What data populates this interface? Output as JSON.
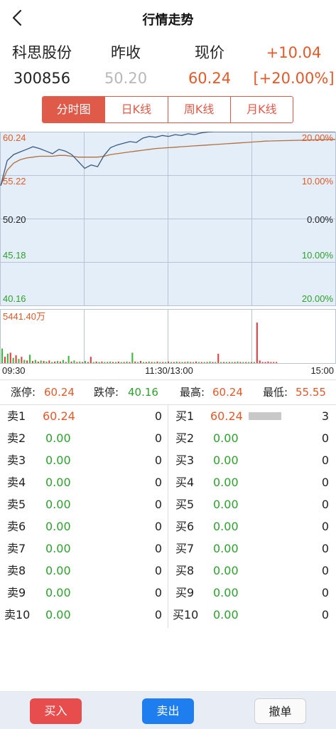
{
  "header": {
    "title": "行情走势",
    "back_icon": "chevron-left-icon"
  },
  "quote": {
    "name": "科思股份",
    "code": "300856",
    "prev_close_label": "昨收",
    "prev_close": "50.20",
    "current_label": "现价",
    "current": "60.24",
    "change": "+10.04",
    "change_pct": "[+20.00%]"
  },
  "tabs": [
    {
      "label": "分时图",
      "active": true
    },
    {
      "label": "日K线",
      "active": false
    },
    {
      "label": "周K线",
      "active": false
    },
    {
      "label": "月K线",
      "active": false
    }
  ],
  "chart_data": {
    "type": "line",
    "price_levels": [
      "60.24",
      "55.22",
      "50.20",
      "45.18",
      "40.16"
    ],
    "pct_levels": [
      "20.00%",
      "10.00%",
      "0.00%",
      "10.00%",
      "20.00%"
    ],
    "volume_label": "5441.40万",
    "x_ticks": [
      "09:30",
      "11:30/13:00",
      "15:00"
    ],
    "ylim": [
      40.16,
      60.24
    ],
    "reference": 50.2,
    "series": [
      {
        "values": [
          54.0,
          56.9,
          57.6,
          57.9,
          58.2,
          58.5,
          58.3,
          58.0,
          57.7,
          58.2,
          58.0,
          57.6,
          56.8,
          56.0,
          56.4,
          56.2,
          57.5,
          58.4,
          58.7,
          58.9,
          59.1,
          59.0,
          59.5,
          59.7,
          59.6,
          59.8,
          59.7,
          59.9,
          59.8,
          60.0,
          59.9,
          60.1,
          60.2,
          60.24,
          60.24,
          60.24,
          60.24,
          60.24,
          60.24,
          60.24,
          60.24,
          60.24
        ]
      },
      {
        "values": [
          54.0,
          55.8,
          56.6,
          57.0,
          57.2,
          57.3,
          57.4,
          57.4,
          57.4,
          57.5,
          57.5,
          57.4,
          57.3,
          57.3,
          57.3,
          57.3,
          57.4,
          57.6,
          57.7,
          57.8,
          57.9,
          58.0,
          58.1,
          58.2,
          58.3,
          58.35,
          58.4,
          58.45,
          58.5,
          58.55,
          58.6,
          58.65,
          58.7,
          58.75,
          58.8,
          58.85,
          58.9,
          58.95,
          59.0,
          59.05,
          59.1,
          59.15
        ]
      }
    ],
    "volume": [
      {
        "v": 0.28,
        "c": "green"
      },
      {
        "v": 0.12,
        "c": "red"
      },
      {
        "v": 0.18,
        "c": "green"
      },
      {
        "v": 0.2,
        "c": "red"
      },
      {
        "v": 0.1,
        "c": "green"
      },
      {
        "v": 0.15,
        "c": "red"
      },
      {
        "v": 0.08,
        "c": "green"
      },
      {
        "v": 0.12,
        "c": "red"
      },
      {
        "v": 0.06,
        "c": "green"
      },
      {
        "v": 0.05,
        "c": "red"
      },
      {
        "v": 0.16,
        "c": "green"
      },
      {
        "v": 0.04,
        "c": "red"
      },
      {
        "v": 0.06,
        "c": "green"
      },
      {
        "v": 0.03,
        "c": "red"
      },
      {
        "v": 0.05,
        "c": "green"
      },
      {
        "v": 0.04,
        "c": "red"
      },
      {
        "v": 0.03,
        "c": "green"
      },
      {
        "v": 0.05,
        "c": "red"
      },
      {
        "v": 0.02,
        "c": "green"
      },
      {
        "v": 0.03,
        "c": "red"
      },
      {
        "v": 0.04,
        "c": "green"
      },
      {
        "v": 0.03,
        "c": "red"
      },
      {
        "v": 0.06,
        "c": "green"
      },
      {
        "v": 0.02,
        "c": "red"
      },
      {
        "v": 0.14,
        "c": "green"
      },
      {
        "v": 0.03,
        "c": "red"
      },
      {
        "v": 0.05,
        "c": "green"
      },
      {
        "v": 0.02,
        "c": "red"
      },
      {
        "v": 0.03,
        "c": "green"
      },
      {
        "v": 0.02,
        "c": "red"
      },
      {
        "v": 0.04,
        "c": "green"
      },
      {
        "v": 0.02,
        "c": "red"
      },
      {
        "v": 0.12,
        "c": "red"
      },
      {
        "v": 0.02,
        "c": "green"
      },
      {
        "v": 0.03,
        "c": "red"
      },
      {
        "v": 0.02,
        "c": "green"
      },
      {
        "v": 0.03,
        "c": "red"
      },
      {
        "v": 0.02,
        "c": "green"
      },
      {
        "v": 0.02,
        "c": "red"
      },
      {
        "v": 0.03,
        "c": "green"
      },
      {
        "v": 0.02,
        "c": "red"
      },
      {
        "v": 0.02,
        "c": "green"
      },
      {
        "v": 0.03,
        "c": "red"
      },
      {
        "v": 0.02,
        "c": "green"
      },
      {
        "v": 0.02,
        "c": "red"
      },
      {
        "v": 0.03,
        "c": "green"
      },
      {
        "v": 0.02,
        "c": "red"
      },
      {
        "v": 0.2,
        "c": "green"
      },
      {
        "v": 0.03,
        "c": "red"
      },
      {
        "v": 0.02,
        "c": "green"
      },
      {
        "v": 0.04,
        "c": "red"
      },
      {
        "v": 0.02,
        "c": "green"
      },
      {
        "v": 0.02,
        "c": "red"
      },
      {
        "v": 0.03,
        "c": "green"
      },
      {
        "v": 0.02,
        "c": "red"
      },
      {
        "v": 0.02,
        "c": "green"
      },
      {
        "v": 0.03,
        "c": "red"
      },
      {
        "v": 0.02,
        "c": "green"
      },
      {
        "v": 0.02,
        "c": "red"
      },
      {
        "v": 0.02,
        "c": "green"
      },
      {
        "v": 0.03,
        "c": "red"
      },
      {
        "v": 0.02,
        "c": "green"
      },
      {
        "v": 0.02,
        "c": "red"
      },
      {
        "v": 0.03,
        "c": "green"
      },
      {
        "v": 0.02,
        "c": "red"
      },
      {
        "v": 0.02,
        "c": "green"
      },
      {
        "v": 0.02,
        "c": "red"
      },
      {
        "v": 0.03,
        "c": "green"
      },
      {
        "v": 0.02,
        "c": "red"
      },
      {
        "v": 0.02,
        "c": "green"
      },
      {
        "v": 0.03,
        "c": "red"
      },
      {
        "v": 0.02,
        "c": "green"
      },
      {
        "v": 0.02,
        "c": "red"
      },
      {
        "v": 0.02,
        "c": "green"
      },
      {
        "v": 0.02,
        "c": "red"
      },
      {
        "v": 0.03,
        "c": "green"
      },
      {
        "v": 0.02,
        "c": "red"
      },
      {
        "v": 0.02,
        "c": "green"
      },
      {
        "v": 0.18,
        "c": "red"
      },
      {
        "v": 0.02,
        "c": "green"
      },
      {
        "v": 0.02,
        "c": "red"
      },
      {
        "v": 0.02,
        "c": "green"
      },
      {
        "v": 0.02,
        "c": "red"
      },
      {
        "v": 0.02,
        "c": "green"
      },
      {
        "v": 0.02,
        "c": "red"
      },
      {
        "v": 0.03,
        "c": "green"
      },
      {
        "v": 0.02,
        "c": "red"
      },
      {
        "v": 0.02,
        "c": "green"
      },
      {
        "v": 0.02,
        "c": "red"
      },
      {
        "v": 0.02,
        "c": "green"
      },
      {
        "v": 0.02,
        "c": "red"
      },
      {
        "v": 0.02,
        "c": "green"
      },
      {
        "v": 0.78,
        "c": "red"
      },
      {
        "v": 0.05,
        "c": "red"
      },
      {
        "v": 0.02,
        "c": "red"
      },
      {
        "v": 0.02,
        "c": "red"
      },
      {
        "v": 0.03,
        "c": "red"
      },
      {
        "v": 0.02,
        "c": "red"
      },
      {
        "v": 0.02,
        "c": "red"
      },
      {
        "v": 0.02,
        "c": "red"
      }
    ]
  },
  "limits": {
    "up_label": "涨停:",
    "up": "60.24",
    "down_label": "跌停:",
    "down": "40.16",
    "high_label": "最高:",
    "high": "60.24",
    "low_label": "最低:",
    "low": "55.55"
  },
  "order_book": {
    "asks": [
      {
        "label": "卖1",
        "price": "60.24",
        "vol": "0"
      },
      {
        "label": "卖2",
        "price": "0.00",
        "vol": "0"
      },
      {
        "label": "卖3",
        "price": "0.00",
        "vol": "0"
      },
      {
        "label": "卖4",
        "price": "0.00",
        "vol": "0"
      },
      {
        "label": "卖5",
        "price": "0.00",
        "vol": "0"
      },
      {
        "label": "卖6",
        "price": "0.00",
        "vol": "0"
      },
      {
        "label": "卖7",
        "price": "0.00",
        "vol": "0"
      },
      {
        "label": "卖8",
        "price": "0.00",
        "vol": "0"
      },
      {
        "label": "卖9",
        "price": "0.00",
        "vol": "0"
      },
      {
        "label": "卖10",
        "price": "0.00",
        "vol": "0"
      }
    ],
    "bids": [
      {
        "label": "买1",
        "price": "60.24",
        "vol": "3",
        "depth": 1.0
      },
      {
        "label": "买2",
        "price": "0.00",
        "vol": "0",
        "depth": 0
      },
      {
        "label": "买3",
        "price": "0.00",
        "vol": "0",
        "depth": 0
      },
      {
        "label": "买4",
        "price": "0.00",
        "vol": "0",
        "depth": 0
      },
      {
        "label": "买5",
        "price": "0.00",
        "vol": "0",
        "depth": 0
      },
      {
        "label": "买6",
        "price": "0.00",
        "vol": "0",
        "depth": 0
      },
      {
        "label": "买7",
        "price": "0.00",
        "vol": "0",
        "depth": 0
      },
      {
        "label": "买8",
        "price": "0.00",
        "vol": "0",
        "depth": 0
      },
      {
        "label": "买9",
        "price": "0.00",
        "vol": "0",
        "depth": 0
      },
      {
        "label": "买10",
        "price": "0.00",
        "vol": "0",
        "depth": 0
      }
    ]
  },
  "actions": {
    "buy": "买入",
    "sell": "卖出",
    "cancel": "撤单"
  },
  "colors": {
    "up": "#e05a2a",
    "down": "#2ea02e",
    "accent": "#e05a4a",
    "line": "#3a5a84",
    "avg": "#b07040",
    "fill": "#e4eef8",
    "grid": "#b8c4d2"
  }
}
